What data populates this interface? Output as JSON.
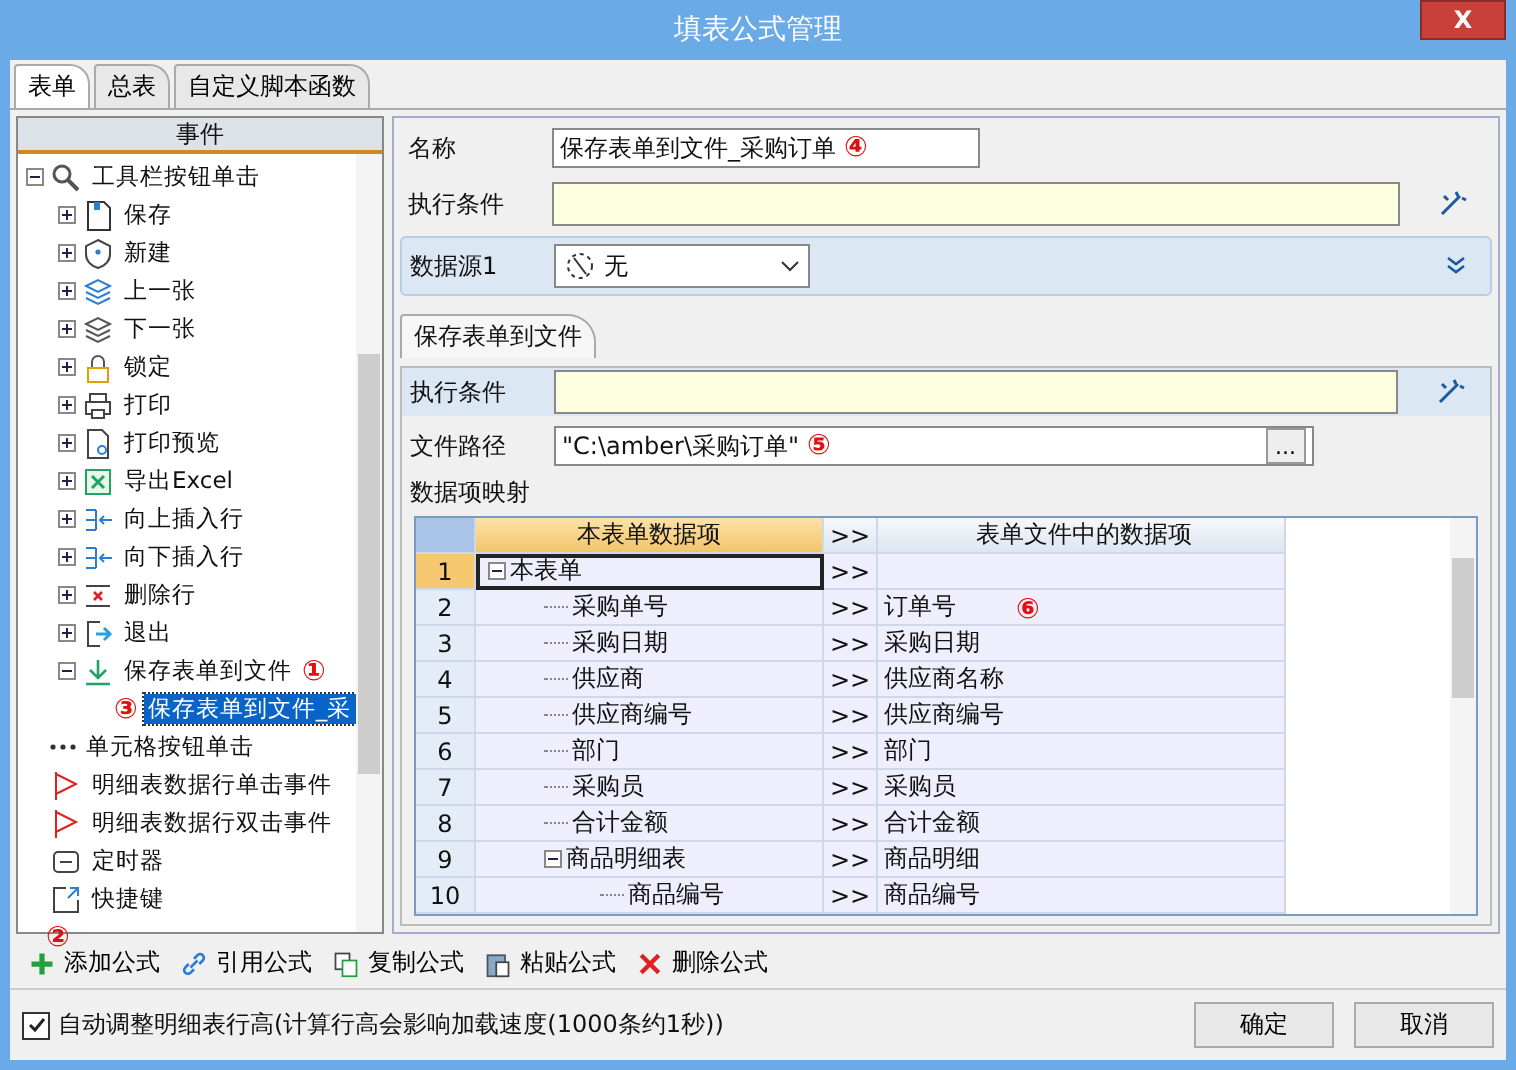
{
  "window": {
    "title": "填表公式管理",
    "close_label": "X"
  },
  "tabs": [
    {
      "label": "表单",
      "selected": true
    },
    {
      "label": "总表",
      "selected": false
    },
    {
      "label": "自定义脚本函数",
      "selected": false
    }
  ],
  "event_panel": {
    "header": "事件",
    "tree": [
      {
        "label": "工具栏按钮单击",
        "expanded": true,
        "selected": false,
        "children": [
          {
            "label": "保存",
            "expanded": false,
            "selected": false
          },
          {
            "label": "新建",
            "expanded": false,
            "selected": false
          },
          {
            "label": "上一张",
            "expanded": false,
            "selected": false
          },
          {
            "label": "下一张",
            "expanded": false,
            "selected": false
          },
          {
            "label": "锁定",
            "expanded": false,
            "selected": false
          },
          {
            "label": "打印",
            "expanded": false,
            "selected": false
          },
          {
            "label": "打印预览",
            "expanded": false,
            "selected": false
          },
          {
            "label": "导出Excel",
            "expanded": false,
            "selected": false
          },
          {
            "label": "向上插入行",
            "expanded": false,
            "selected": false
          },
          {
            "label": "向下插入行",
            "expanded": false,
            "selected": false
          },
          {
            "label": "删除行",
            "expanded": false,
            "selected": false
          },
          {
            "label": "退出",
            "expanded": false,
            "selected": false
          },
          {
            "label": "保存表单到文件",
            "expanded": true,
            "selected": false,
            "badge": "①",
            "children": [
              {
                "label": "保存表单到文件_采",
                "selected": true,
                "badge": "③"
              }
            ]
          }
        ]
      },
      {
        "label": "单元格按钮单击",
        "selected": false
      },
      {
        "label": "明细表数据行单击事件",
        "selected": false
      },
      {
        "label": "明细表数据行双击事件",
        "selected": false
      },
      {
        "label": "定时器",
        "selected": false
      },
      {
        "label": "快捷键",
        "selected": false
      }
    ]
  },
  "form": {
    "name_label": "名称",
    "name_value": "保存表单到文件_采购订单",
    "name_badge": "④",
    "condition_label": "执行条件",
    "datasource_label": "数据源1",
    "datasource_value": "无"
  },
  "action": {
    "tab": "保存表单到文件",
    "condition_label": "执行条件",
    "path_label": "文件路径",
    "path_value": "\"C:\\amber\\采购订单\"",
    "path_badge": "⑤",
    "browse_label": "...",
    "mapping_label": "数据项映射"
  },
  "mapping": {
    "columns": [
      "本表单数据项",
      ">>",
      "表单文件中的数据项"
    ],
    "badge": "⑥",
    "rows": [
      {
        "number": "1",
        "source": "本表单",
        "arrow": ">>",
        "target": "",
        "selected": true,
        "expanded": true,
        "children": [
          {
            "number": "2",
            "source": "采购单号",
            "arrow": ">>",
            "target": "订单号",
            "selected": false
          },
          {
            "number": "3",
            "source": "采购日期",
            "arrow": ">>",
            "target": "采购日期",
            "selected": false
          },
          {
            "number": "4",
            "source": "供应商",
            "arrow": ">>",
            "target": "供应商名称",
            "selected": false
          },
          {
            "number": "5",
            "source": "供应商编号",
            "arrow": ">>",
            "target": "供应商编号",
            "selected": false
          },
          {
            "number": "6",
            "source": "部门",
            "arrow": ">>",
            "target": "部门",
            "selected": false
          },
          {
            "number": "7",
            "source": "采购员",
            "arrow": ">>",
            "target": "采购员",
            "selected": false
          },
          {
            "number": "8",
            "source": "合计金额",
            "arrow": ">>",
            "target": "合计金额",
            "selected": false
          },
          {
            "number": "9",
            "source": "商品明细表",
            "arrow": ">>",
            "target": "商品明细",
            "selected": false,
            "expanded": true,
            "children": [
              {
                "number": "10",
                "source": "商品编号",
                "arrow": ">>",
                "target": "商品编号",
                "selected": false
              }
            ]
          }
        ]
      }
    ]
  },
  "toolbar": [
    {
      "kind": "add",
      "label": "添加公式",
      "badge": "②"
    },
    {
      "kind": "link",
      "label": "引用公式"
    },
    {
      "kind": "copy",
      "label": "复制公式"
    },
    {
      "kind": "paste",
      "label": "粘贴公式"
    },
    {
      "kind": "delete",
      "label": "删除公式"
    }
  ],
  "auto_height": {
    "label": "自动调整明细表行高(计算行高会影响加载速度(1000条约1秒))",
    "checked": true
  },
  "buttons": [
    "确定",
    "取消"
  ]
}
